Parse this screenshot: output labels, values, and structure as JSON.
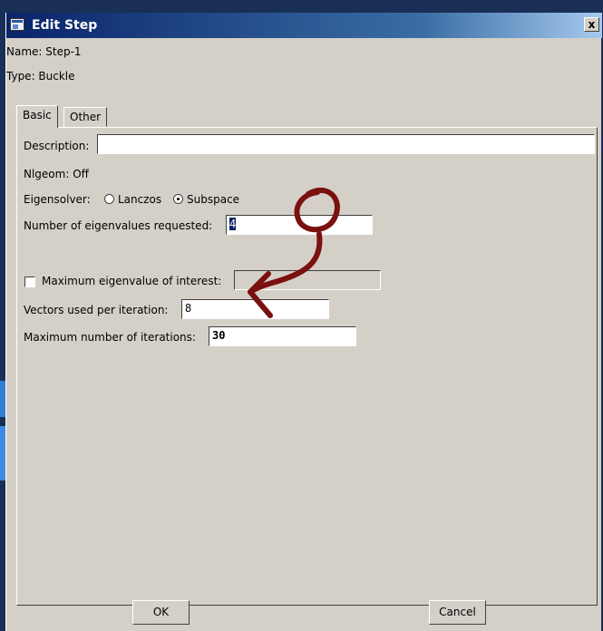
{
  "window": {
    "title": "Edit Step",
    "close_glyph": "x"
  },
  "info": {
    "name": "Name:  Step-1",
    "type": "Type:  Buckle"
  },
  "tabs": [
    {
      "label": "Basic"
    },
    {
      "label": "Other"
    }
  ],
  "form": {
    "description_label": "Description:",
    "description_value": "",
    "nlgeom": "Nlgeom:  Off",
    "eigensolver_label": "Eigensolver:",
    "eigensolver_options": [
      {
        "label": "Lanczos",
        "selected": false
      },
      {
        "label": "Subspace",
        "selected": true
      }
    ],
    "num_eigenvalues_label": "Number of eigenvalues requested:",
    "num_eigenvalues_value": "4",
    "max_eigenvalue_label": "Maximum eigenvalue of interest:",
    "max_eigenvalue_checked": false,
    "max_eigenvalue_value": "",
    "vectors_label": "Vectors used per iteration:",
    "vectors_value": "8",
    "max_iterations_label": "Maximum number of iterations:",
    "max_iterations_value": "30"
  },
  "buttons": {
    "ok": "OK",
    "cancel": "Cancel"
  },
  "colors": {
    "dialog_bg": "#d4d0c8",
    "titlebar": "#0a246a",
    "annotation": "#7a1010"
  },
  "icons": {
    "window": "window-icon",
    "close": "close-icon",
    "arrow": "hand-drawn-arrow-icon"
  }
}
